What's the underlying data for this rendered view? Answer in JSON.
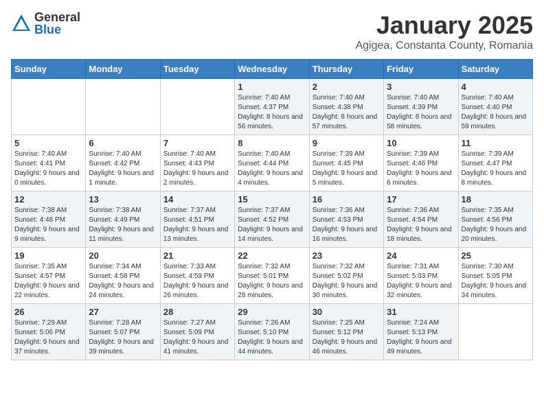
{
  "logo": {
    "general": "General",
    "blue": "Blue"
  },
  "title": "January 2025",
  "location": "Agigea, Constanta County, Romania",
  "days_of_week": [
    "Sunday",
    "Monday",
    "Tuesday",
    "Wednesday",
    "Thursday",
    "Friday",
    "Saturday"
  ],
  "weeks": [
    [
      {
        "day": "",
        "content": ""
      },
      {
        "day": "",
        "content": ""
      },
      {
        "day": "",
        "content": ""
      },
      {
        "day": "1",
        "content": "Sunrise: 7:40 AM\nSunset: 4:37 PM\nDaylight: 8 hours\nand 56 minutes."
      },
      {
        "day": "2",
        "content": "Sunrise: 7:40 AM\nSunset: 4:38 PM\nDaylight: 8 hours\nand 57 minutes."
      },
      {
        "day": "3",
        "content": "Sunrise: 7:40 AM\nSunset: 4:39 PM\nDaylight: 8 hours\nand 58 minutes."
      },
      {
        "day": "4",
        "content": "Sunrise: 7:40 AM\nSunset: 4:40 PM\nDaylight: 8 hours\nand 59 minutes."
      }
    ],
    [
      {
        "day": "5",
        "content": "Sunrise: 7:40 AM\nSunset: 4:41 PM\nDaylight: 9 hours\nand 0 minutes."
      },
      {
        "day": "6",
        "content": "Sunrise: 7:40 AM\nSunset: 4:42 PM\nDaylight: 9 hours\nand 1 minute."
      },
      {
        "day": "7",
        "content": "Sunrise: 7:40 AM\nSunset: 4:43 PM\nDaylight: 9 hours\nand 2 minutes."
      },
      {
        "day": "8",
        "content": "Sunrise: 7:40 AM\nSunset: 4:44 PM\nDaylight: 9 hours\nand 4 minutes."
      },
      {
        "day": "9",
        "content": "Sunrise: 7:39 AM\nSunset: 4:45 PM\nDaylight: 9 hours\nand 5 minutes."
      },
      {
        "day": "10",
        "content": "Sunrise: 7:39 AM\nSunset: 4:46 PM\nDaylight: 9 hours\nand 6 minutes."
      },
      {
        "day": "11",
        "content": "Sunrise: 7:39 AM\nSunset: 4:47 PM\nDaylight: 9 hours\nand 8 minutes."
      }
    ],
    [
      {
        "day": "12",
        "content": "Sunrise: 7:38 AM\nSunset: 4:48 PM\nDaylight: 9 hours\nand 9 minutes."
      },
      {
        "day": "13",
        "content": "Sunrise: 7:38 AM\nSunset: 4:49 PM\nDaylight: 9 hours\nand 11 minutes."
      },
      {
        "day": "14",
        "content": "Sunrise: 7:37 AM\nSunset: 4:51 PM\nDaylight: 9 hours\nand 13 minutes."
      },
      {
        "day": "15",
        "content": "Sunrise: 7:37 AM\nSunset: 4:52 PM\nDaylight: 9 hours\nand 14 minutes."
      },
      {
        "day": "16",
        "content": "Sunrise: 7:36 AM\nSunset: 4:53 PM\nDaylight: 9 hours\nand 16 minutes."
      },
      {
        "day": "17",
        "content": "Sunrise: 7:36 AM\nSunset: 4:54 PM\nDaylight: 9 hours\nand 18 minutes."
      },
      {
        "day": "18",
        "content": "Sunrise: 7:35 AM\nSunset: 4:56 PM\nDaylight: 9 hours\nand 20 minutes."
      }
    ],
    [
      {
        "day": "19",
        "content": "Sunrise: 7:35 AM\nSunset: 4:57 PM\nDaylight: 9 hours\nand 22 minutes."
      },
      {
        "day": "20",
        "content": "Sunrise: 7:34 AM\nSunset: 4:58 PM\nDaylight: 9 hours\nand 24 minutes."
      },
      {
        "day": "21",
        "content": "Sunrise: 7:33 AM\nSunset: 4:59 PM\nDaylight: 9 hours\nand 26 minutes."
      },
      {
        "day": "22",
        "content": "Sunrise: 7:32 AM\nSunset: 5:01 PM\nDaylight: 9 hours\nand 28 minutes."
      },
      {
        "day": "23",
        "content": "Sunrise: 7:32 AM\nSunset: 5:02 PM\nDaylight: 9 hours\nand 30 minutes."
      },
      {
        "day": "24",
        "content": "Sunrise: 7:31 AM\nSunset: 5:03 PM\nDaylight: 9 hours\nand 32 minutes."
      },
      {
        "day": "25",
        "content": "Sunrise: 7:30 AM\nSunset: 5:05 PM\nDaylight: 9 hours\nand 34 minutes."
      }
    ],
    [
      {
        "day": "26",
        "content": "Sunrise: 7:29 AM\nSunset: 5:06 PM\nDaylight: 9 hours\nand 37 minutes."
      },
      {
        "day": "27",
        "content": "Sunrise: 7:28 AM\nSunset: 5:07 PM\nDaylight: 9 hours\nand 39 minutes."
      },
      {
        "day": "28",
        "content": "Sunrise: 7:27 AM\nSunset: 5:09 PM\nDaylight: 9 hours\nand 41 minutes."
      },
      {
        "day": "29",
        "content": "Sunrise: 7:26 AM\nSunset: 5:10 PM\nDaylight: 9 hours\nand 44 minutes."
      },
      {
        "day": "30",
        "content": "Sunrise: 7:25 AM\nSunset: 5:12 PM\nDaylight: 9 hours\nand 46 minutes."
      },
      {
        "day": "31",
        "content": "Sunrise: 7:24 AM\nSunset: 5:13 PM\nDaylight: 9 hours\nand 49 minutes."
      },
      {
        "day": "",
        "content": ""
      }
    ]
  ]
}
